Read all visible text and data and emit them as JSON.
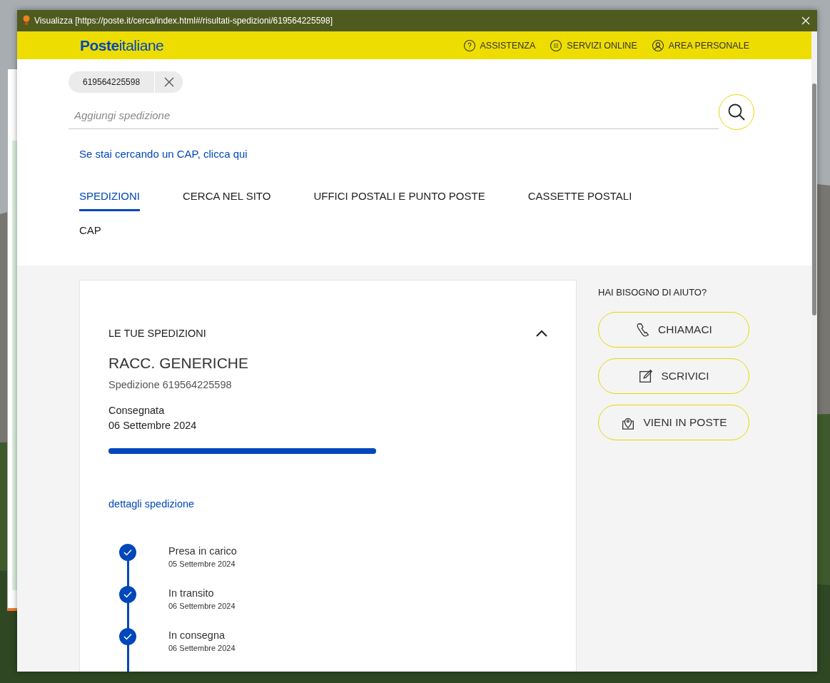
{
  "window": {
    "title": "Visualizza [https://poste.it/cerca/index.html#/risultati-spedizioni/619564225598]"
  },
  "header": {
    "logo_bold": "Poste",
    "logo_light": "italiane",
    "links": [
      {
        "kind": "help",
        "label": "ASSISTENZA"
      },
      {
        "kind": "grid",
        "label": "SERVIZI ONLINE"
      },
      {
        "kind": "user",
        "label": "AREA PERSONALE"
      }
    ]
  },
  "search": {
    "chip": "619564225598",
    "placeholder": "Aggiungi spedizione"
  },
  "cap_link": "Se stai cercando un CAP, clicca qui",
  "tabs": [
    {
      "label": "SPEDIZIONI",
      "selected": true
    },
    {
      "label": "CERCA NEL SITO",
      "selected": false
    },
    {
      "label": "UFFICI POSTALI E PUNTO POSTE",
      "selected": false
    },
    {
      "label": "CASSETTE POSTALI",
      "selected": false
    },
    {
      "label": "CAP",
      "selected": false
    }
  ],
  "shipment": {
    "section": "LE TUE SPEDIZIONI",
    "expanded": true,
    "type": "RACC. GENERICHE",
    "number": "Spedizione 619564225598",
    "status": "Consegnata",
    "date": "06 Settembre 2024",
    "level": 1,
    "details_link": "dettagli spedizione",
    "steps": [
      {
        "label": "Presa in carico",
        "date": "05 Settembre 2024",
        "done": true
      },
      {
        "label": "In transito",
        "date": "06 Settembre 2024",
        "done": true
      },
      {
        "label": "In consegna",
        "date": "06 Settembre 2024",
        "done": true
      }
    ]
  },
  "help": {
    "title": "HAI BISOGNO DI AIUTO?",
    "buttons": [
      {
        "kind": "phone",
        "label": "CHIAMACI"
      },
      {
        "kind": "write",
        "label": "SCRIVICI"
      },
      {
        "kind": "place",
        "label": "VIENI IN POSTE"
      }
    ]
  }
}
